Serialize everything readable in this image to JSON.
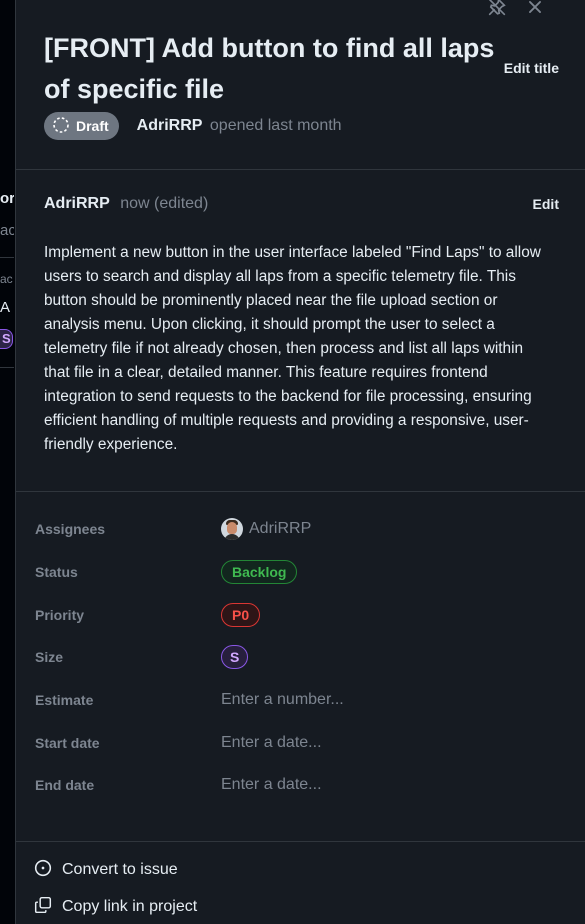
{
  "background": {
    "fragments": [
      "ore",
      "ac",
      "ac",
      "A"
    ],
    "size_chip": "S"
  },
  "header": {
    "title": "[FRONT] Add button to find all laps of specific file",
    "edit_title_label": "Edit title",
    "draft_label": "Draft",
    "author": "AdriRRP",
    "opened_text": "opened last month"
  },
  "icons": {
    "unpin": "unpin-icon",
    "close": "close-icon",
    "draft": "draft-circle-icon",
    "convert": "issue-opened-icon",
    "copy": "copy-icon"
  },
  "comment": {
    "author": "AdriRRP",
    "time": "now (edited)",
    "edit_label": "Edit",
    "body": "Implement a new button in the user interface labeled \"Find Laps\" to allow users to search and display all laps from a specific telemetry file. This button should be prominently placed near the file upload section or analysis menu. Upon clicking, it should prompt the user to select a telemetry file if not already chosen, then process and list all laps within that file in a clear, detailed manner. This feature requires frontend integration to send requests to the backend for file processing, ensuring efficient handling of multiple requests and providing a responsive, user-friendly experience."
  },
  "fields": {
    "assignees": {
      "label": "Assignees",
      "value": "AdriRRP"
    },
    "status": {
      "label": "Status",
      "value": "Backlog"
    },
    "priority": {
      "label": "Priority",
      "value": "P0"
    },
    "size": {
      "label": "Size",
      "value": "S"
    },
    "estimate": {
      "label": "Estimate",
      "placeholder": "Enter a number..."
    },
    "start_date": {
      "label": "Start date",
      "placeholder": "Enter a date..."
    },
    "end_date": {
      "label": "End date",
      "placeholder": "Enter a date..."
    }
  },
  "actions": {
    "convert": "Convert to issue",
    "copy_link": "Copy link in project"
  },
  "colors": {
    "background": "#0d1117",
    "panel": "#161b22",
    "status_green": "#3fb950",
    "priority_red": "#f85149",
    "size_purple": "#d2a8ff",
    "draft_gray": "#6e7681"
  }
}
